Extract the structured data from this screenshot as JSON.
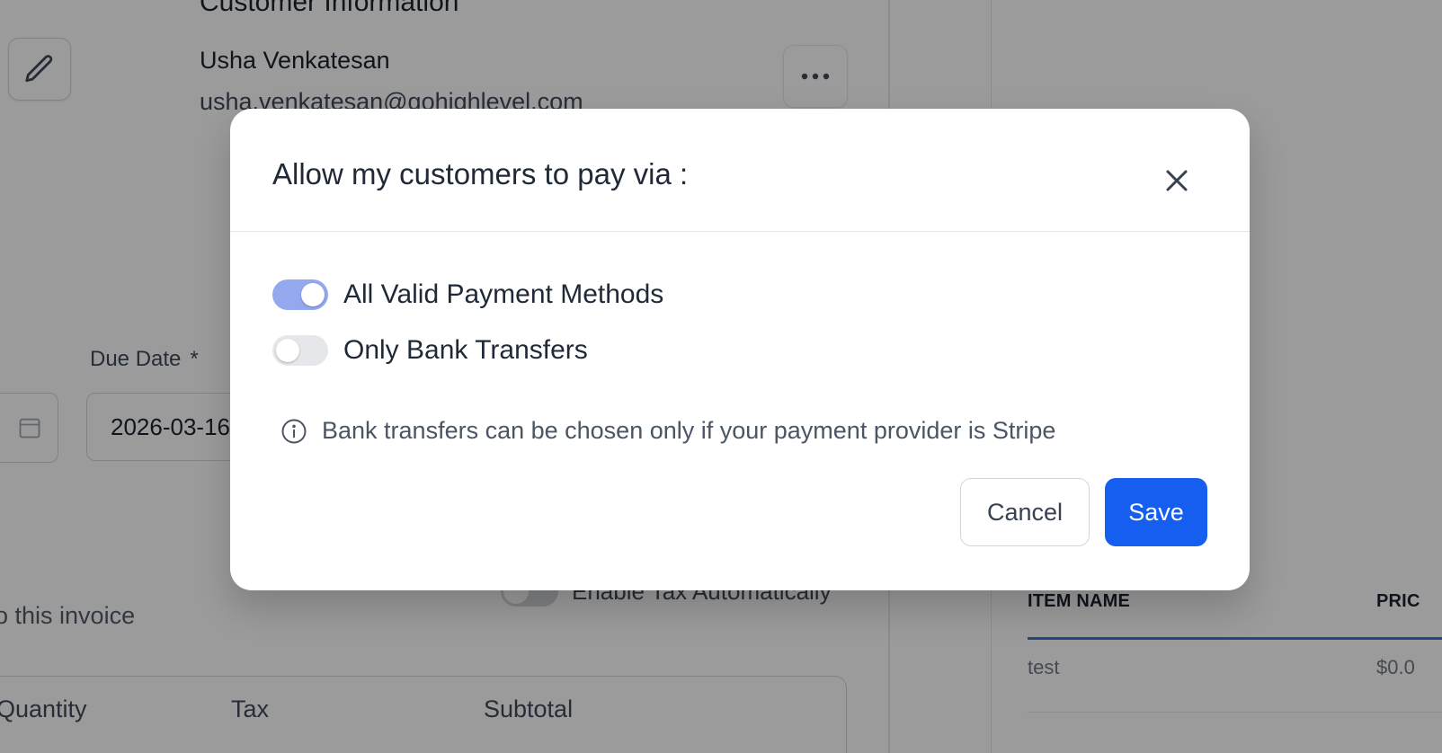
{
  "background": {
    "section_title": "Customer Information",
    "customer": {
      "name": "Usha Venkatesan",
      "email": "usha.venkatesan@gohighlevel.com"
    },
    "due_date": {
      "label": "Due Date",
      "required_mark": "*",
      "value": "2026-03-16"
    },
    "tax_toggle_label": "Enable Tax Automatically",
    "invoice_text": "o this invoice",
    "table_headers": [
      "Quantity",
      "Tax",
      "Subtotal"
    ],
    "preview": {
      "headers": [
        "ITEM NAME",
        "PRIC"
      ],
      "row": {
        "name": "test",
        "price": "$0.0"
      }
    }
  },
  "modal": {
    "title": "Allow my customers to pay via :",
    "options": [
      {
        "label": "All Valid Payment Methods",
        "enabled": true
      },
      {
        "label": "Only Bank Transfers",
        "enabled": false
      }
    ],
    "info": "Bank transfers can be chosen only if your payment provider is Stripe",
    "cancel_label": "Cancel",
    "save_label": "Save"
  },
  "colors": {
    "primary": "#155eef",
    "toggle_on": "#94a8ee",
    "toggle_off": "#e5e7eb",
    "overlay": "rgba(17,17,17,0.42)"
  },
  "icons": [
    "pencil-icon",
    "more-horizontal-icon",
    "calendar-icon",
    "close-icon",
    "info-icon"
  ]
}
